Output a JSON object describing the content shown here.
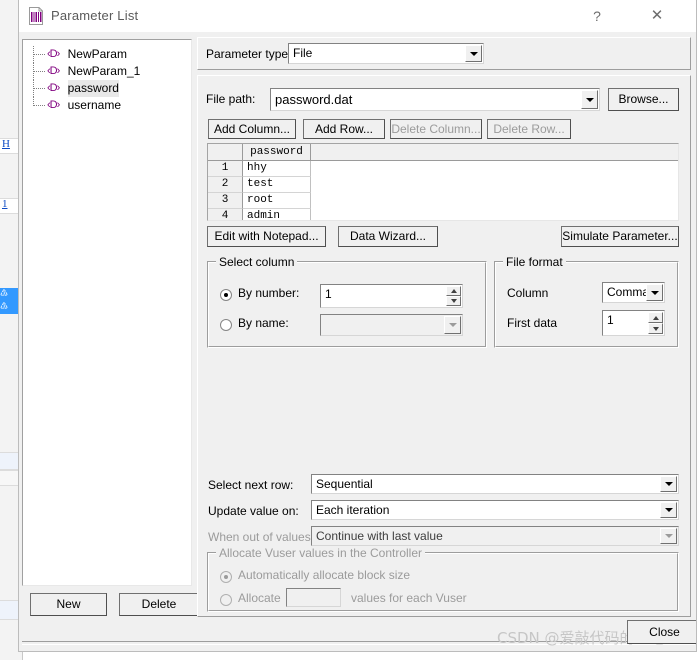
{
  "window": {
    "title": "Parameter List",
    "icon": "parameter-list-icon",
    "help_label": "?",
    "close_label": "✕"
  },
  "tree": {
    "items": [
      {
        "label": "NewParam",
        "icon": "parameter-icon",
        "selected": false
      },
      {
        "label": "NewParam_1",
        "icon": "parameter-icon",
        "selected": false
      },
      {
        "label": "password",
        "icon": "parameter-icon",
        "selected": true
      },
      {
        "label": "username",
        "icon": "parameter-icon",
        "selected": false
      }
    ],
    "icon_glyph": "‹D›",
    "new_label": "New",
    "delete_label": "Delete"
  },
  "parameter_type": {
    "label": "Parameter type:",
    "value": "File"
  },
  "file": {
    "path_label": "File path:",
    "path_value": "password.dat",
    "browse_label": "Browse...",
    "add_column_label": "Add Column...",
    "add_row_label": "Add Row...",
    "delete_column_label": "Delete Column...",
    "delete_row_label": "Delete Row..."
  },
  "grid": {
    "corner_label": "",
    "columns": [
      "password"
    ],
    "rows": [
      {
        "num": "1",
        "values": [
          "hhy"
        ]
      },
      {
        "num": "2",
        "values": [
          "test"
        ]
      },
      {
        "num": "3",
        "values": [
          "root"
        ]
      },
      {
        "num": "4",
        "values": [
          "admin"
        ]
      }
    ]
  },
  "actions": {
    "edit_notepad_label": "Edit with Notepad...",
    "data_wizard_label": "Data Wizard...",
    "simulate_parameter_label": "Simulate Parameter..."
  },
  "select_column": {
    "title": "Select column",
    "by_number_label": "By number:",
    "by_number_value": "1",
    "by_number_selected": true,
    "by_name_label": "By name:",
    "by_name_value": "",
    "by_name_selected": false
  },
  "file_format": {
    "title": "File format",
    "column_label": "Column",
    "column_value": "Comma",
    "first_data_label": "First data",
    "first_data_value": "1"
  },
  "options": {
    "select_next_row_label": "Select next row:",
    "select_next_row_value": "Sequential",
    "update_value_on_label": "Update value on:",
    "update_value_on_value": "Each iteration",
    "when_out_of_values_label": "When out of values:",
    "when_out_of_values_value": "Continue with last value"
  },
  "allocate": {
    "title": "Allocate Vuser values in the Controller",
    "auto_label": "Automatically allocate block size",
    "auto_selected": true,
    "manual_label": "Allocate",
    "manual_value": "",
    "manual_suffix": "values for each Vuser",
    "manual_selected": false
  },
  "footer": {
    "close_label": "Close",
    "watermark": "CSDN @爱敲代码的二毛"
  },
  "background": {
    "label_1": "H",
    "label_2": "1"
  }
}
